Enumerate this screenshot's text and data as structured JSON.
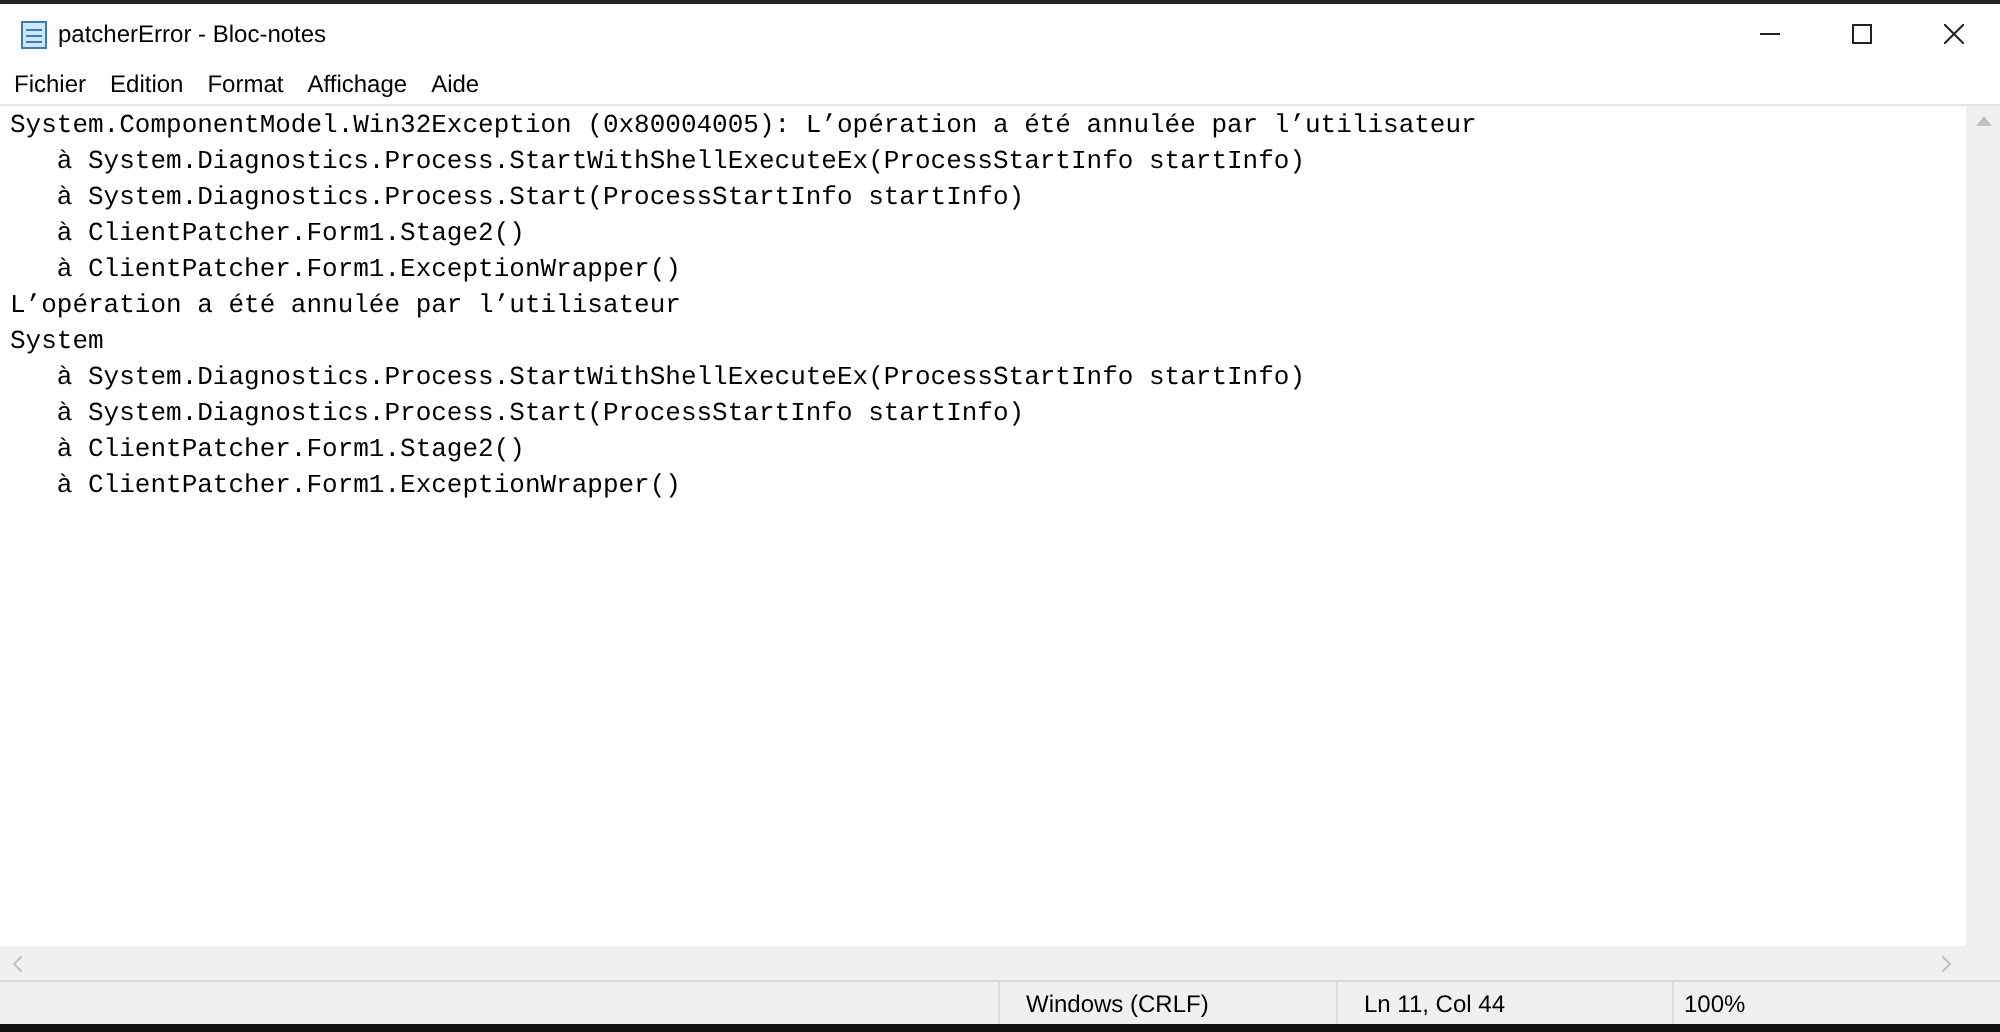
{
  "window": {
    "title": "patcherError - Bloc-notes"
  },
  "menu": [
    "Fichier",
    "Edition",
    "Format",
    "Affichage",
    "Aide"
  ],
  "editor": {
    "lines": [
      "System.ComponentModel.Win32Exception (0x80004005): L’opération a été annulée par l’utilisateur",
      "   à System.Diagnostics.Process.StartWithShellExecuteEx(ProcessStartInfo startInfo)",
      "   à System.Diagnostics.Process.Start(ProcessStartInfo startInfo)",
      "   à ClientPatcher.Form1.Stage2()",
      "   à ClientPatcher.Form1.ExceptionWrapper()",
      "L’opération a été annulée par l’utilisateur",
      "System",
      "   à System.Diagnostics.Process.StartWithShellExecuteEx(ProcessStartInfo startInfo)",
      "   à System.Diagnostics.Process.Start(ProcessStartInfo startInfo)",
      "   à ClientPatcher.Form1.Stage2()",
      "   à ClientPatcher.Form1.ExceptionWrapper()"
    ]
  },
  "status_bar": {
    "line_ending": "Windows (CRLF)",
    "position": "Ln 11, Col 44",
    "zoom": "100%"
  }
}
